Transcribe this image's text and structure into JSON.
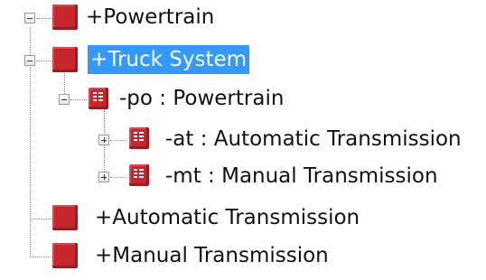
{
  "tree": {
    "nodes": [
      {
        "label": "+Powertrain",
        "expanded": true,
        "icon": "class-icon"
      },
      {
        "label": "+Truck System",
        "expanded": true,
        "selected": true,
        "icon": "class-icon"
      },
      {
        "label": "-po : Powertrain",
        "expanded": true,
        "icon": "part-icon"
      },
      {
        "label": "-at : Automatic Transmission",
        "expanded": false,
        "icon": "part-icon"
      },
      {
        "label": "-mt : Manual Transmission",
        "expanded": false,
        "icon": "part-icon"
      },
      {
        "label": "+Automatic Transmission",
        "icon": "class-icon"
      },
      {
        "label": "+Manual Transmission",
        "icon": "class-icon"
      }
    ]
  },
  "colors": {
    "selection": "#3399ff",
    "icon_red": "#c8262d"
  }
}
